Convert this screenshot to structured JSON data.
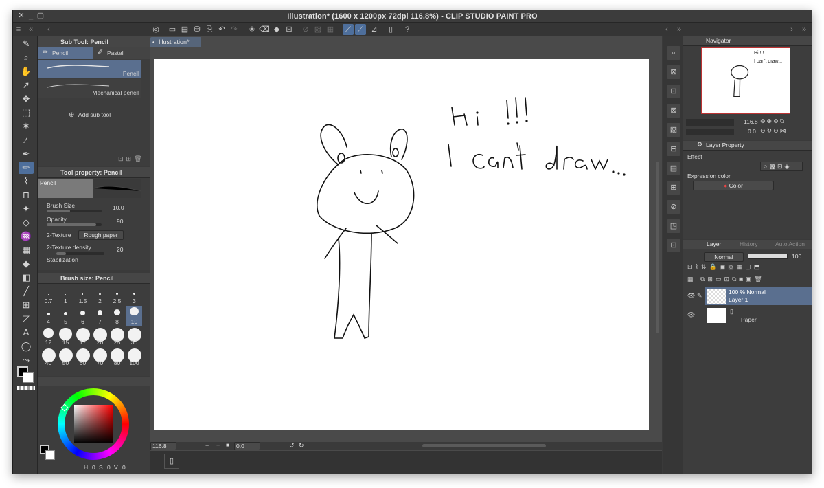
{
  "window": {
    "title": "Illustration* (1600 x 1200px 72dpi 116.8%)  - CLIP STUDIO PAINT PRO"
  },
  "document_tab": {
    "label": "Illustration*"
  },
  "sub_tool_panel": {
    "title": "Sub Tool: Pencil",
    "tabs": [
      "Pencil",
      "Pastel"
    ],
    "brushes": [
      "Pencil",
      "Mechanical pencil"
    ],
    "add_label": "Add sub tool"
  },
  "tool_property_panel": {
    "title": "Tool property: Pencil",
    "preview_label": "Pencil",
    "brush_size": {
      "label": "Brush Size",
      "value": "10.0"
    },
    "opacity": {
      "label": "Opacity",
      "value": "90"
    },
    "texture": {
      "label": "2-Texture",
      "value": "Rough paper"
    },
    "texture_density": {
      "label": "2-Texture density",
      "value": "20"
    },
    "stabilization": {
      "label": "Stabilization"
    }
  },
  "brush_size_panel": {
    "title": "Brush size: Pencil",
    "sizes": [
      "0.7",
      "1",
      "1.5",
      "2",
      "2.5",
      "3",
      "4",
      "5",
      "6",
      "7",
      "8",
      "10",
      "12",
      "15",
      "17",
      "20",
      "25",
      "30",
      "40",
      "50",
      "60",
      "70",
      "80",
      "100"
    ],
    "selected": "10"
  },
  "color_panel": {
    "values": [
      "0",
      "0",
      "0"
    ]
  },
  "canvas_status": {
    "zoom": "116.8",
    "rotation": "0.0"
  },
  "drawing_text": {
    "line1": "Hi !!!",
    "line2": "I can't draw..."
  },
  "navigator": {
    "tabs": [
      "Navigator"
    ],
    "zoom": "116.8",
    "rotation": "0.0",
    "mini_text1": "Hi !!!",
    "mini_text2": "I can't draw..."
  },
  "layer_property": {
    "title": "Layer Property",
    "effect_label": "Effect",
    "expression_label": "Expression color",
    "expression_value": "Color"
  },
  "layer_panel": {
    "tabs": [
      "Layer",
      "History",
      "Auto Action"
    ],
    "blend_mode": "Normal",
    "opacity": "100",
    "layers": [
      {
        "top_text": "100 %  Normal",
        "name": "Layer 1"
      },
      {
        "top_text": "",
        "name": "Paper"
      }
    ]
  },
  "icons": {
    "close": "close-icon",
    "minimize": "minimize-icon",
    "maximize": "maximize-icon",
    "eye": "eye-icon",
    "pencil": "pencil-icon"
  },
  "colors": {
    "accent": "#4e6f9c",
    "panel_bg": "#3d3d3d",
    "foreground_color": "#000000",
    "background_color": "#ffffff"
  }
}
